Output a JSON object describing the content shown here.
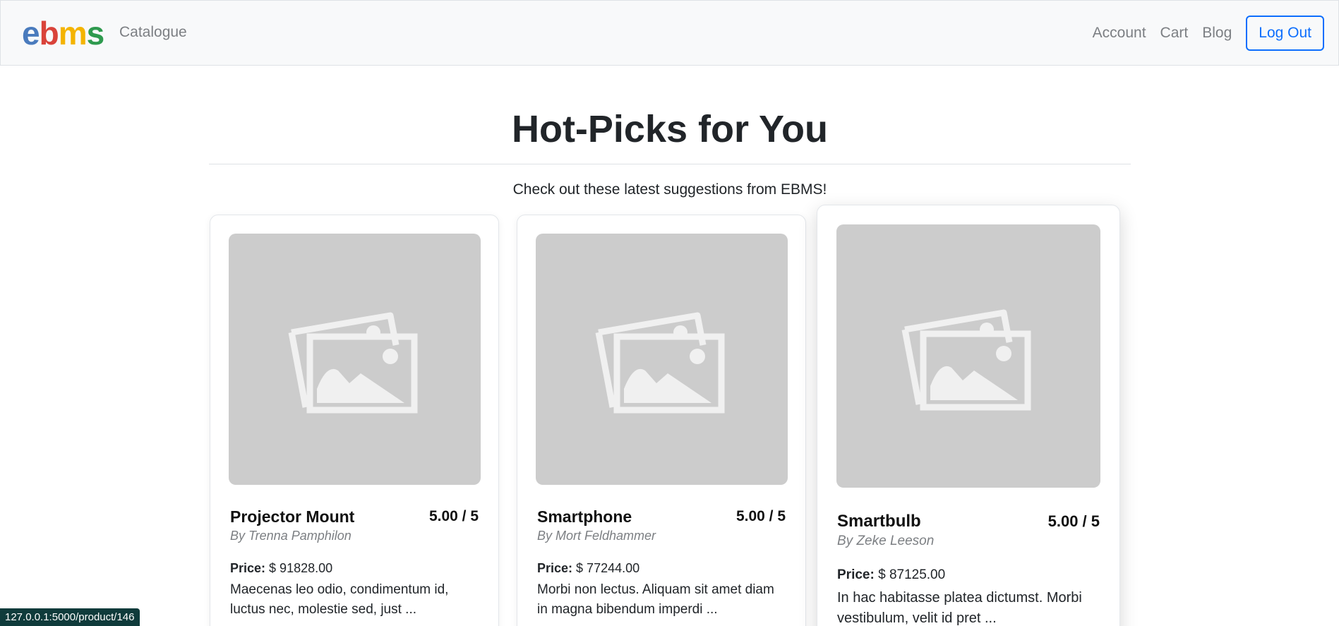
{
  "navbar": {
    "brand_letters": [
      {
        "char": "e",
        "color": "#4a7bbd"
      },
      {
        "char": "b",
        "color": "#d9433a"
      },
      {
        "char": "m",
        "color": "#f4b400"
      },
      {
        "char": "s",
        "color": "#2e9a4e"
      }
    ],
    "catalogue_label": "Catalogue",
    "account_label": "Account",
    "cart_label": "Cart",
    "blog_label": "Blog",
    "logout_label": "Log Out"
  },
  "main": {
    "heading": "Hot-Picks for You",
    "subtitle": "Check out these latest suggestions from EBMS!"
  },
  "products": [
    {
      "title": "Projector Mount",
      "rating": "5.00 / 5",
      "author": "By Trenna Pamphilon",
      "price_label": "Price:",
      "price_value": "$ 91828.00",
      "description_line1": "Maecenas leo odio, condimentum id,",
      "description_line2": "luctus nec, molestie sed, just ..."
    },
    {
      "title": "Smartphone",
      "rating": "5.00 / 5",
      "author": "By Mort Feldhammer",
      "price_label": "Price:",
      "price_value": "$ 77244.00",
      "description_line1": "Morbi non lectus. Aliquam sit amet diam",
      "description_line2": "in magna bibendum imperdi ..."
    },
    {
      "title": "Smartbulb",
      "rating": "5.00 / 5",
      "author": "By Zeke Leeson",
      "price_label": "Price:",
      "price_value": "$ 87125.00",
      "description_line1": "In hac habitasse platea dictumst. Morbi",
      "description_line2": "vestibulum, velit id pret ..."
    }
  ],
  "status_bar": {
    "url": "127.0.0.1:5000/product/146"
  },
  "colors": {
    "placeholder_bg": "#cccccc",
    "placeholder_icon": "#f0f0f0",
    "logout_accent": "#0d6efd"
  },
  "icons": {
    "product_image": "image-placeholder-icon"
  }
}
